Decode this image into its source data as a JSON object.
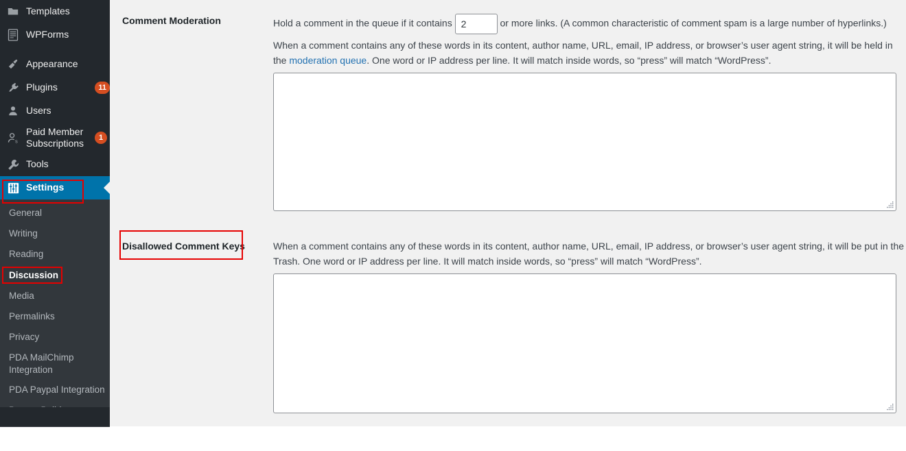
{
  "colors": {
    "sidebar_bg": "#23282d",
    "submenu_bg": "#32373c",
    "active_blue": "#0073aa",
    "badge": "#d54e21",
    "content_bg": "#f1f1f1",
    "link": "#2271b1",
    "annotation": "#e60000"
  },
  "sidebar": {
    "items": [
      {
        "label": "Templates",
        "icon": "templates-icon",
        "badge": null
      },
      {
        "label": "WPForms",
        "icon": "wpforms-icon",
        "badge": null
      },
      {
        "label": "Appearance",
        "icon": "appearance-icon",
        "badge": null
      },
      {
        "label": "Plugins",
        "icon": "plugins-icon",
        "badge": "11"
      },
      {
        "label": "Users",
        "icon": "users-icon",
        "badge": null
      },
      {
        "label": "Paid Member Subscriptions",
        "icon": "paid-member-subscriptions-icon",
        "badge": "1"
      },
      {
        "label": "Tools",
        "icon": "tools-icon",
        "badge": null
      },
      {
        "label": "Settings",
        "icon": "settings-icon",
        "badge": null
      }
    ],
    "submenu": [
      {
        "label": "General"
      },
      {
        "label": "Writing"
      },
      {
        "label": "Reading"
      },
      {
        "label": "Discussion"
      },
      {
        "label": "Media"
      },
      {
        "label": "Permalinks"
      },
      {
        "label": "Privacy"
      },
      {
        "label": "PDA MailChimp Integration"
      },
      {
        "label": "PDA Paypal Integration"
      },
      {
        "label": "Beaver Builder"
      }
    ]
  },
  "settings": {
    "comment_moderation": {
      "label": "Comment Moderation",
      "hold_prefix": "Hold a comment in the queue if it contains",
      "links_value": "2",
      "hold_suffix": "or more links. (A common characteristic of comment spam is a large number of hyperlinks.)",
      "desc_line1": "When a comment contains any of these words in its content, author name, URL, email, IP address, or browser’s user agent string, it will be held in the",
      "desc_link": "moderation queue",
      "desc_line2": ". One word or IP address per line. It will match inside words, so “press” will match “WordPress”.",
      "textarea_value": "",
      "textarea_placeholder": ""
    },
    "disallowed_comment_keys": {
      "label": "Disallowed Comment Keys",
      "desc_line1": "When a comment contains any of these words in its content, author name, URL, email, IP address, or browser’s user agent string, it will be put in the",
      "desc_line2": "Trash. One word or IP address per line. It will match inside words, so “press” will match “WordPress”.",
      "textarea_value": "",
      "textarea_placeholder": ""
    }
  }
}
